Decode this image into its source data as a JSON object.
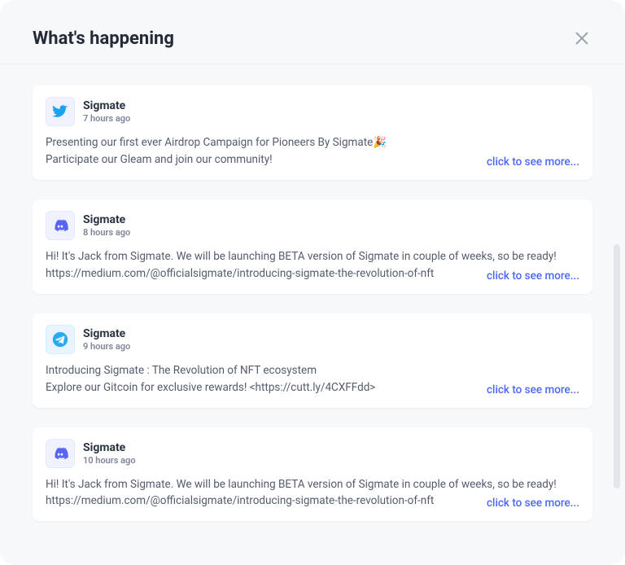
{
  "header": {
    "title": "What's happening"
  },
  "see_more_label": "click to see more...",
  "posts": [
    {
      "platform": "twitter",
      "author": "Sigmate",
      "time": "7 hours ago",
      "body": "Presenting our first ever Airdrop Campaign for Pioneers By Sigmate🎉\nParticipate our Gleam and join our community!"
    },
    {
      "platform": "discord",
      "author": "Sigmate",
      "time": "8 hours ago",
      "body": "Hi! It's Jack from Sigmate. We will be launching BETA version of Sigmate in couple of weeks, so be ready! https://medium.com/@officialsigmate/introducing-sigmate-the-revolution-of-nft"
    },
    {
      "platform": "telegram",
      "author": "Sigmate",
      "time": "9 hours ago",
      "body": "Introducing Sigmate : The Revolution of NFT ecosystem\nExplore our Gitcoin for exclusive rewards! <https://cutt.ly/4CXFFdd>"
    },
    {
      "platform": "discord",
      "author": "Sigmate",
      "time": "10 hours ago",
      "body": "Hi! It's Jack from Sigmate. We will be launching BETA version of Sigmate in couple of weeks, so be ready! https://medium.com/@officialsigmate/introducing-sigmate-the-revolution-of-nft"
    }
  ]
}
